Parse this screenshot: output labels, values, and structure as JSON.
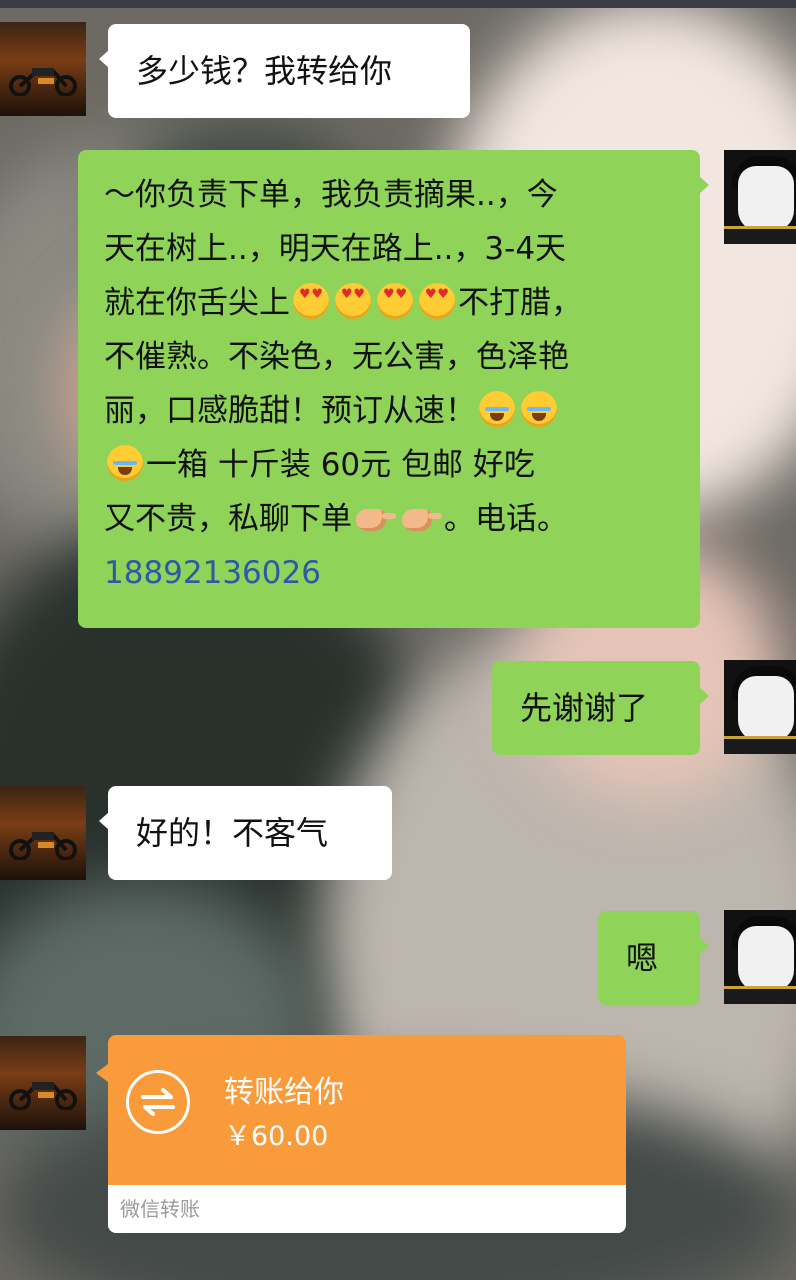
{
  "messages": {
    "m1": "多少钱？我转给你",
    "m2": {
      "line1": "～你负责下单，我负责摘果..，今",
      "line2": "天在树上..，明天在路上..，3-4天",
      "line3a": "就在你舌尖上",
      "line3b": "不打腊，",
      "line4": "不催熟。不染色，无公害，色泽艳",
      "line5": "丽，口感脆甜！预订从速！",
      "line6": "一箱  十斤装  60元 包邮   好吃",
      "line7a": "又不贵，私聊下单",
      "line7b": "。电话。",
      "phone": "18892136026"
    },
    "m3": "先谢谢了",
    "m4": "好的！不客气",
    "m5": "嗯"
  },
  "transfer": {
    "title": "转账给你",
    "amount": "￥60.00",
    "footer": "微信转账"
  },
  "colors": {
    "sent_bubble": "#8fd459",
    "received_bubble": "#ffffff",
    "transfer_card": "#f99b3a",
    "phone_link": "#2c5aa6"
  },
  "icons": {
    "left_avatar": "motorcycle-avatar",
    "right_avatar": "anime-boy-avatar",
    "transfer": "transfer-arrows-icon",
    "emoji_heart_eyes": "heart-eyes-emoji",
    "emoji_laugh_cry": "laughing-tears-emoji",
    "emoji_hand": "pointing-hand-emoji"
  }
}
